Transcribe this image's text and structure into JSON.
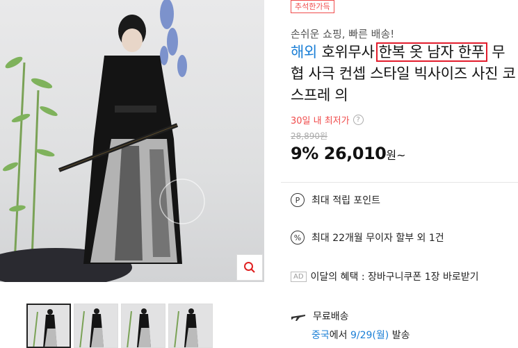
{
  "product": {
    "badge": "추석한가득",
    "subtitle": "손쉬운 쇼핑, 빠른 배송!",
    "title_overseas": "해외",
    "title_part1": "호위무사",
    "title_highlight": "한복 옷 남자 한푸",
    "title_part2": "무협 사극 컨셉 스타일 빅사이즈 사진 코스프레 의",
    "lowest_label": "30일 내 최저가",
    "lowest_help": "?",
    "original_price": "28,890원",
    "discount": "9%",
    "price": "26,010",
    "price_unit": "원~"
  },
  "benefits": [
    {
      "icon": "P",
      "text": "최대 적립 포인트"
    },
    {
      "icon": "%",
      "text": "최대 22개월 무이자 할부 외 1건"
    },
    {
      "icon": "AD",
      "text": "이달의 혜택 : 장바구니쿠폰 1장 바로받기"
    }
  ],
  "shipping": {
    "label": "무료배송",
    "origin": "중국",
    "origin_suffix": "에서",
    "date": "9/29(월)",
    "ship_word": "발송"
  },
  "colors": {
    "accent": "#1b7fd6",
    "highlight_border": "#e21c2c",
    "badge": "#f04b4b"
  }
}
